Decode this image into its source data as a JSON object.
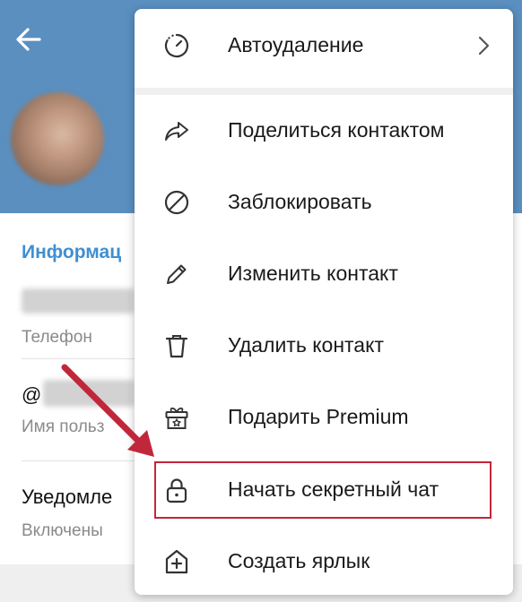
{
  "header": {
    "back_icon": "arrow-left-icon",
    "bg_color": "#5a8fbf"
  },
  "info": {
    "section_title": "Информац",
    "phone_label": "Телефон",
    "username_prefix": "@",
    "username_label": "Имя польз",
    "notifications_title": "Уведомле",
    "notifications_status": "Включены"
  },
  "menu": {
    "items": [
      {
        "label": "Автоудаление",
        "icon": "timer-icon"
      },
      {
        "label": "Поделиться контактом",
        "icon": "share-icon"
      },
      {
        "label": "Заблокировать",
        "icon": "block-icon"
      },
      {
        "label": "Изменить контакт",
        "icon": "pencil-icon"
      },
      {
        "label": "Удалить контакт",
        "icon": "trash-icon"
      },
      {
        "label": "Подарить Premium",
        "icon": "gift-icon"
      },
      {
        "label": "Начать секретный чат",
        "icon": "lock-icon"
      },
      {
        "label": "Создать ярлык",
        "icon": "add-shortcut-icon"
      }
    ]
  },
  "annotation": {
    "highlight_color": "#c0273a"
  }
}
